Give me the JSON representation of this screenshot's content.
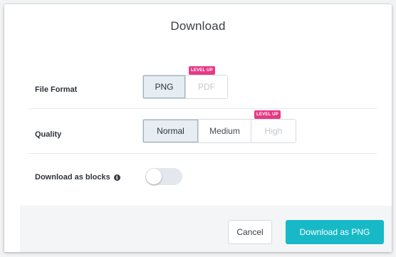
{
  "dialog": {
    "title": "Download"
  },
  "file_format": {
    "label": "File Format",
    "options": [
      {
        "label": "PNG",
        "state": "selected"
      },
      {
        "label": "PDF",
        "state": "locked",
        "badge": "LEVEL UP"
      }
    ]
  },
  "quality": {
    "label": "Quality",
    "options": [
      {
        "label": "Normal",
        "state": "selected"
      },
      {
        "label": "Medium",
        "state": "available"
      },
      {
        "label": "High",
        "state": "locked",
        "badge": "LEVEL UP"
      }
    ]
  },
  "download_as_blocks": {
    "label": "Download as blocks",
    "info_icon": "info-icon",
    "info_glyph": "i",
    "toggle_on": false
  },
  "footer": {
    "cancel_label": "Cancel",
    "primary_label": "Download as PNG"
  },
  "colors": {
    "primary": "#18b9c7",
    "badge": "#e63a86",
    "selected_bg": "#e6edf3"
  }
}
